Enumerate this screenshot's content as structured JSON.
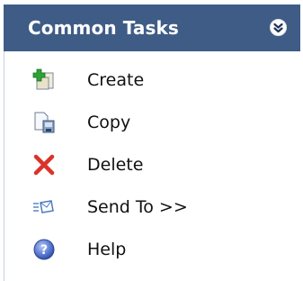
{
  "panel": {
    "title": "Common Tasks",
    "collapse_icon": "double-chevron-up-icon",
    "header_color": "#3f5c86"
  },
  "tasks": [
    {
      "label": "Create",
      "icon": "create-icon"
    },
    {
      "label": "Copy",
      "icon": "copy-icon"
    },
    {
      "label": "Delete",
      "icon": "delete-icon"
    },
    {
      "label": "Send To >>",
      "icon": "send-to-icon"
    },
    {
      "label": "Help",
      "icon": "help-icon"
    }
  ]
}
